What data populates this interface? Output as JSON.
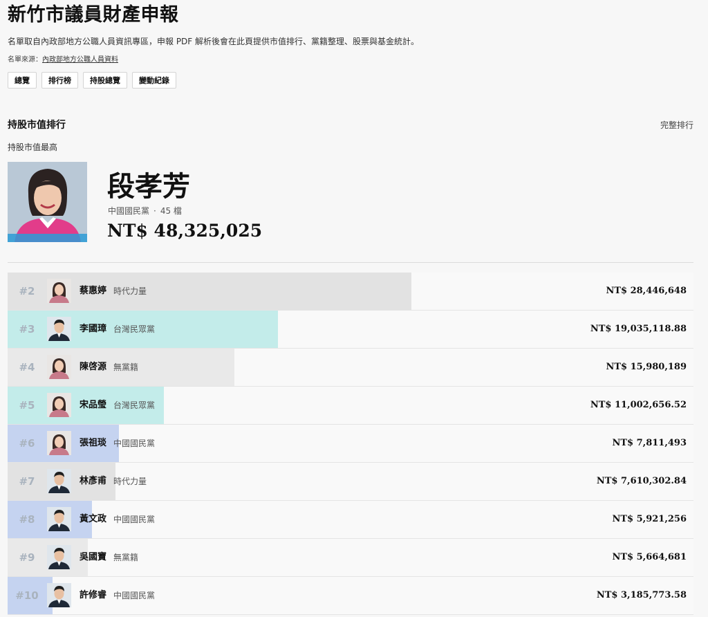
{
  "header": {
    "title": "新竹市議員財產申報",
    "description": "名單取自內政部地方公職人員資訊專區，申報 PDF 解析後會在此頁提供市值排行、黨籍整理、股票與基金統計。",
    "source_label": "名單來源：",
    "source_link": "內政部地方公職人員資料"
  },
  "nav": [
    "總覽",
    "排行榜",
    "持股總覽",
    "變動紀錄"
  ],
  "section": {
    "title": "持股市值排行",
    "link": "完整排行",
    "top_label": "持股市值最高"
  },
  "top": {
    "name": "段孝芳",
    "party": "中國國民黨",
    "separator": "·",
    "holdings": "45 檔",
    "value": "NT$ 48,325,025"
  },
  "colors": {
    "時代力量": "#e2e2e2",
    "台灣民眾黨": "#c3ecea",
    "無黨籍": "#e9e9e9",
    "中國國民黨": "#c5d3f0"
  },
  "ranking": [
    {
      "rank": "#2",
      "name": "蔡惠婷",
      "party": "時代力量",
      "value": "NT$ 28,446,648",
      "share": 0.589,
      "avatar": "female"
    },
    {
      "rank": "#3",
      "name": "李國璋",
      "party": "台灣民眾黨",
      "value": "NT$ 19,035,118.88",
      "share": 0.394,
      "avatar": "male"
    },
    {
      "rank": "#4",
      "name": "陳啓源",
      "party": "無黨籍",
      "value": "NT$ 15,980,189",
      "share": 0.331,
      "avatar": "female"
    },
    {
      "rank": "#5",
      "name": "宋品瑩",
      "party": "台灣民眾黨",
      "value": "NT$ 11,002,656.52",
      "share": 0.228,
      "avatar": "female"
    },
    {
      "rank": "#6",
      "name": "張祖琰",
      "party": "中國國民黨",
      "value": "NT$ 7,811,493",
      "share": 0.162,
      "avatar": "female"
    },
    {
      "rank": "#7",
      "name": "林彥甫",
      "party": "時代力量",
      "value": "NT$ 7,610,302.84",
      "share": 0.157,
      "avatar": "male"
    },
    {
      "rank": "#8",
      "name": "黃文政",
      "party": "中國國民黨",
      "value": "NT$ 5,921,256",
      "share": 0.123,
      "avatar": "male"
    },
    {
      "rank": "#9",
      "name": "吳國寶",
      "party": "無黨籍",
      "value": "NT$ 5,664,681",
      "share": 0.117,
      "avatar": "male"
    },
    {
      "rank": "#10",
      "name": "許修睿",
      "party": "中國國民黨",
      "value": "NT$ 3,185,773.58",
      "share": 0.066,
      "avatar": "male"
    }
  ]
}
